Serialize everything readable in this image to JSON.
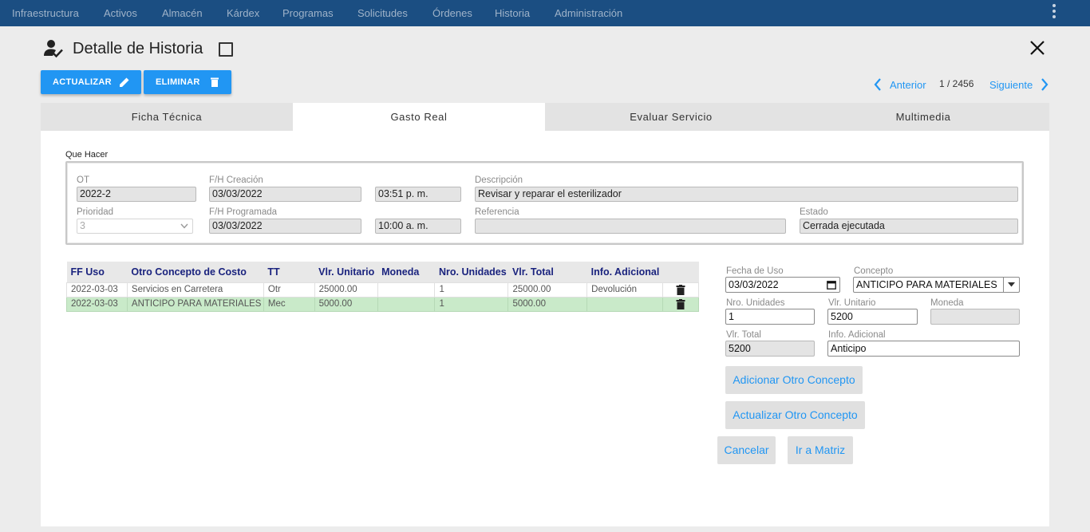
{
  "nav": {
    "items": [
      "Infraestructura",
      "Activos",
      "Almacén",
      "Kárdex",
      "Programas",
      "Solicitudes",
      "Órdenes",
      "Historia",
      "Administración"
    ]
  },
  "header": {
    "title": "Detalle de Historia",
    "actualizar": "ACTUALIZAR",
    "eliminar": "ELIMINAR"
  },
  "pager": {
    "prev": "Anterior",
    "count": "1 / 2456",
    "next": "Siguiente"
  },
  "tabs": [
    "Ficha Técnica",
    "Gasto Real",
    "Evaluar Servicio",
    "Multimedia"
  ],
  "que_hacer": {
    "legend": "Que Hacer",
    "ot_label": "OT",
    "ot": "2022-2",
    "fh_creacion_label": "F/H Creación",
    "fh_creacion_fecha": "03/03/2022",
    "fh_creacion_hora": "03:51 p. m.",
    "descripcion_label": "Descripción",
    "descripcion": "Revisar y reparar el esterilizador",
    "prioridad_label": "Prioridad",
    "prioridad": "3",
    "fh_programada_label": "F/H Programada",
    "fh_programada_fecha": "03/03/2022",
    "fh_programada_hora": "10:00 a. m.",
    "referencia_label": "Referencia",
    "referencia": "",
    "estado_label": "Estado",
    "estado": "Cerrada ejecutada"
  },
  "table": {
    "headers": [
      "FF Uso",
      "Otro Concepto de Costo",
      "TT",
      "Vlr. Unitario",
      "Moneda",
      "Nro. Unidades",
      "Vlr. Total",
      "Info. Adicional",
      ""
    ],
    "rows": [
      [
        "2022-03-03",
        "Servicios en Carretera",
        "Otr",
        "25000.00",
        "",
        "1",
        "25000.00",
        "Devolución"
      ],
      [
        "2022-03-03",
        "ANTICIPO PARA MATERIALES",
        "Mec",
        "5000.00",
        "",
        "1",
        "5000.00",
        ""
      ]
    ]
  },
  "form": {
    "fecha_uso_label": "Fecha de Uso",
    "fecha_uso": "03/03/2022",
    "concepto_label": "Concepto",
    "concepto": "ANTICIPO PARA MATERIALES",
    "nro_unidades_label": "Nro. Unidades",
    "nro_unidades": "1",
    "vlr_unitario_label": "Vlr. Unitario",
    "vlr_unitario": "5200",
    "moneda_label": "Moneda",
    "moneda": "",
    "vlr_total_label": "Vlr. Total",
    "vlr_total": "5200",
    "info_adicional_label": "Info. Adicional",
    "info_adicional": "Anticipo",
    "btn_adicionar": "Adicionar Otro Concepto",
    "btn_actualizar": "Actualizar Otro Concepto",
    "btn_cancelar": "Cancelar",
    "btn_matriz": "Ir a Matriz"
  },
  "colors": {
    "nav": "#1b4e82",
    "accent": "#2196f3",
    "selected_row": "#c9eac9"
  }
}
